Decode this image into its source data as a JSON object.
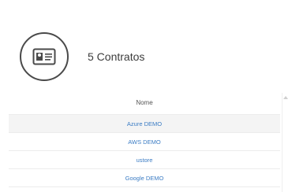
{
  "header": {
    "icon": "id-card-icon",
    "title": "5 Contratos"
  },
  "table": {
    "column_header": "Nome",
    "rows": [
      {
        "name": "Azure DEMO"
      },
      {
        "name": "AWS DEMO"
      },
      {
        "name": "ustore"
      },
      {
        "name": "Google DEMO"
      }
    ]
  },
  "colors": {
    "link": "#3b7cc4",
    "icon_stroke": "#4a4a4a",
    "row_alt": "#f4f4f4"
  }
}
